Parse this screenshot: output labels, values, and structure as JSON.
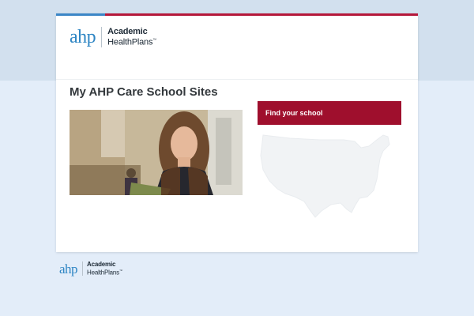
{
  "brand": {
    "mark": "ahp",
    "name_line1": "Academic",
    "name_line2": "HealthPlans",
    "trademark": "™",
    "colors": {
      "blue": "#3b86c6",
      "crimson": "#9f0f2d"
    }
  },
  "page": {
    "title": "My AHP Care School Sites"
  },
  "actions": {
    "find_school_label": "Find your school"
  },
  "icons": {
    "map": "us-map-icon"
  }
}
